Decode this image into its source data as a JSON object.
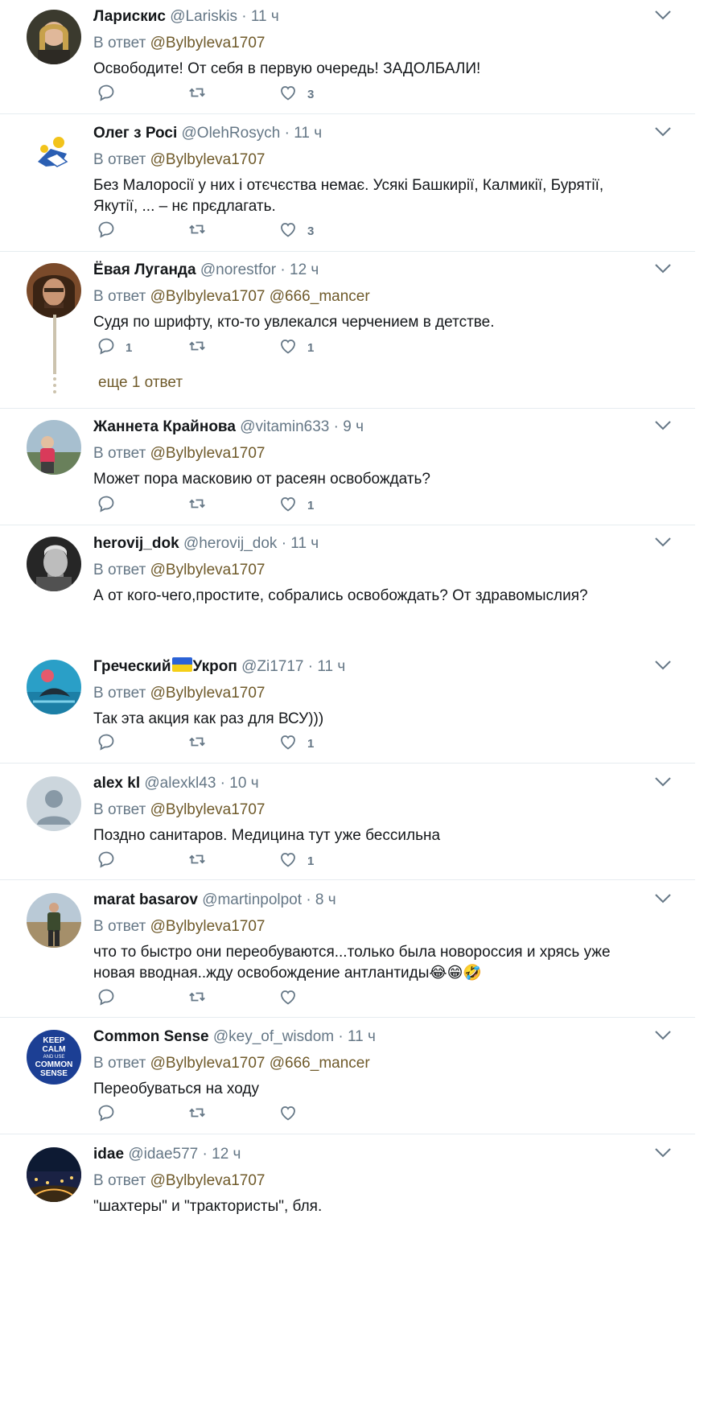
{
  "reply_prefix": "В ответ",
  "colors": {
    "link": "#6f5a2a",
    "muted": "#657786",
    "separator": "#e6ecf0",
    "thread": "#ccc3ae"
  },
  "tweets": [
    {
      "name": "Ларискис",
      "handle": "@Lariskis",
      "dot": "·",
      "time": "11 ч",
      "mentions": [
        "@Bylbyleva1707"
      ],
      "text": "Освободите! От себя в первую очередь! ЗАДОЛБАЛИ!",
      "reply_count": "",
      "retweet_count": "",
      "like_count": "3",
      "avatar": "woman-photo"
    },
    {
      "name": "Олег з Росі",
      "handle": "@OlehRosych",
      "dot": "·",
      "time": "11 ч",
      "mentions": [
        "@Bylbyleva1707"
      ],
      "text": "Без Малоросії у них і отєчєства немає. Усякі Башкирії, Калмикії, Бурятії, Якутії, ... – нє прєдлагать.",
      "reply_count": "",
      "retweet_count": "",
      "like_count": "3",
      "avatar": "judo-logo"
    },
    {
      "name": "Ёвая Луганда",
      "handle": "@norestfor",
      "dot": "·",
      "time": "12 ч",
      "mentions": [
        "@Bylbyleva1707",
        "@666_mancer"
      ],
      "text": "Судя по шрифту, кто-то увлекался черчением в детстве.",
      "reply_count": "1",
      "retweet_count": "",
      "like_count": "1",
      "more_replies": "еще 1 ответ",
      "avatar": "man-longhair-photo"
    },
    {
      "name": "Жаннета Крайнова",
      "handle": "@vitamin633",
      "dot": "·",
      "time": "9 ч",
      "mentions": [
        "@Bylbyleva1707"
      ],
      "text": "Может пора масковию от расеян освобождать?",
      "reply_count": "",
      "retweet_count": "",
      "like_count": "1",
      "avatar": "woman-outdoor-photo"
    },
    {
      "name": "herovij_dok",
      "handle": "@herovij_dok",
      "dot": "·",
      "time": "11 ч",
      "mentions": [
        "@Bylbyleva1707"
      ],
      "text": "А от кого-чего,простите, собрались освобождать? От здравомыслия?",
      "reply_count": "",
      "retweet_count": "",
      "like_count": "",
      "avatar": "bw-man-photo"
    },
    {
      "name_before_flag": "Греческий",
      "name_after_flag": "Укроп",
      "handle": "@Zi1717",
      "dot": "·",
      "time": "11 ч",
      "mentions": [
        "@Bylbyleva1707"
      ],
      "text": "Так эта акция как раз для ВСУ)))",
      "reply_count": "",
      "retweet_count": "",
      "like_count": "1",
      "avatar": "dolphin-photo"
    },
    {
      "name": "alex kl",
      "handle": "@alexkl43",
      "dot": "·",
      "time": "10 ч",
      "mentions": [
        "@Bylbyleva1707"
      ],
      "text": "Поздно санитаров. Медицина тут уже бессильна",
      "reply_count": "",
      "retweet_count": "",
      "like_count": "1",
      "avatar": "default-avatar"
    },
    {
      "name": "marat basarov",
      "handle": "@martinpolpot",
      "dot": "·",
      "time": "8 ч",
      "mentions": [
        "@Bylbyleva1707"
      ],
      "text": "что то быстро они переобуваются...только была новороссия и хрясь уже новая вводная..жду освобождение антлантиды😂😁🤣",
      "reply_count": "",
      "retweet_count": "",
      "like_count": "",
      "avatar": "man-beach-photo"
    },
    {
      "name": "Common Sense",
      "handle": "@key_of_wisdom",
      "dot": "·",
      "time": "11 ч",
      "mentions": [
        "@Bylbyleva1707",
        "@666_mancer"
      ],
      "text": "Переобуваться на ходу",
      "reply_count": "",
      "retweet_count": "",
      "like_count": "",
      "avatar": "keep-calm-badge",
      "avatar_text": [
        "KEEP",
        "CALM",
        "AND USE",
        "COMMON",
        "SENSE"
      ]
    },
    {
      "name": "idae",
      "handle": "@idae577",
      "dot": "·",
      "time": "12 ч",
      "mentions": [
        "@Bylbyleva1707"
      ],
      "text": "\"шахтеры\" и \"трактористы\", бля.",
      "reply_count": "",
      "retweet_count": "",
      "like_count": "",
      "avatar": "night-city-photo"
    }
  ]
}
